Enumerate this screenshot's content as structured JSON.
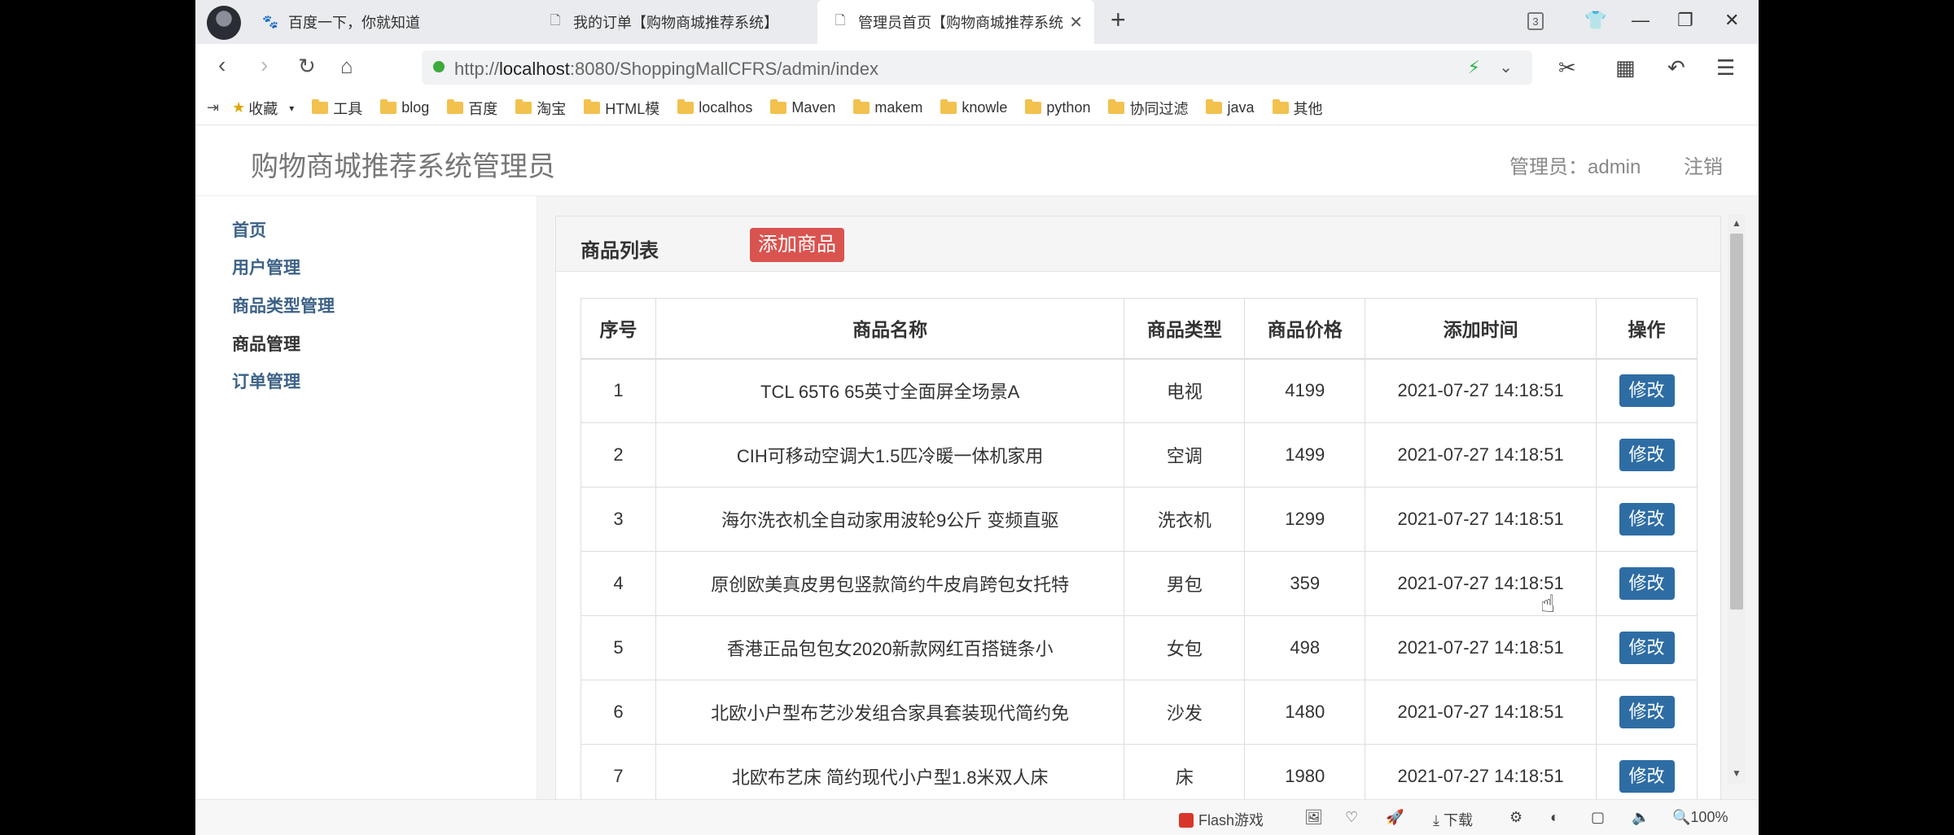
{
  "browser": {
    "tabs": [
      {
        "label": "百度一下，你就知道",
        "icon": "baidu-paw-icon"
      },
      {
        "label": "我的订单【购物商城推荐系统】",
        "icon": "page-icon"
      },
      {
        "label": "管理员首页【购物商城推荐系统",
        "icon": "page-icon"
      }
    ],
    "tab_count": "3",
    "url_prefix": "http://",
    "url_host": "localhost",
    "url_rest": ":8080/ShoppingMallCFRS/admin/index"
  },
  "bookmarks": [
    {
      "label": "收藏"
    },
    {
      "label": "工具"
    },
    {
      "label": "blog"
    },
    {
      "label": "百度"
    },
    {
      "label": "淘宝"
    },
    {
      "label": "HTML模"
    },
    {
      "label": "localhos"
    },
    {
      "label": "Maven"
    },
    {
      "label": "makem"
    },
    {
      "label": "knowle"
    },
    {
      "label": "python"
    },
    {
      "label": "协同过滤"
    },
    {
      "label": "java"
    },
    {
      "label": "其他"
    }
  ],
  "header": {
    "site_title": "购物商城推荐系统管理员",
    "admin_label": "管理员：admin",
    "logout": "注销"
  },
  "sidebar": {
    "items": [
      {
        "label": "首页"
      },
      {
        "label": "用户管理"
      },
      {
        "label": "商品类型管理"
      },
      {
        "label": "商品管理"
      },
      {
        "label": "订单管理"
      }
    ],
    "active": "商品管理"
  },
  "panel": {
    "title": "商品列表",
    "add_button": "添加商品"
  },
  "table": {
    "headers": [
      "序号",
      "商品名称",
      "商品类型",
      "商品价格",
      "添加时间",
      "操作"
    ],
    "edit_label": "修改",
    "rows": [
      {
        "id": "1",
        "name": "TCL 65T6 65英寸全面屏全场景A",
        "type": "电视",
        "price": "4199",
        "time": "2021-07-27 14:18:51"
      },
      {
        "id": "2",
        "name": "CIH可移动空调大1.5匹冷暖一体机家用",
        "type": "空调",
        "price": "1499",
        "time": "2021-07-27 14:18:51"
      },
      {
        "id": "3",
        "name": "海尔洗衣机全自动家用波轮9公斤 变频直驱",
        "type": "洗衣机",
        "price": "1299",
        "time": "2021-07-27 14:18:51"
      },
      {
        "id": "4",
        "name": "原创欧美真皮男包竖款简约牛皮肩跨包女托特",
        "type": "男包",
        "price": "359",
        "time": "2021-07-27 14:18:51"
      },
      {
        "id": "5",
        "name": "香港正品包包女2020新款网红百搭链条小",
        "type": "女包",
        "price": "498",
        "time": "2021-07-27 14:18:51"
      },
      {
        "id": "6",
        "name": "北欧小户型布艺沙发组合家具套装现代简约免",
        "type": "沙发",
        "price": "1480",
        "time": "2021-07-27 14:18:51"
      },
      {
        "id": "7",
        "name": "北欧布艺床 简约现代小户型1.8米双人床",
        "type": "床",
        "price": "1980",
        "time": "2021-07-27 14:18:51"
      }
    ]
  },
  "statusbar": {
    "flash": "Flash游戏",
    "download": "下载",
    "zoom": "100%"
  }
}
